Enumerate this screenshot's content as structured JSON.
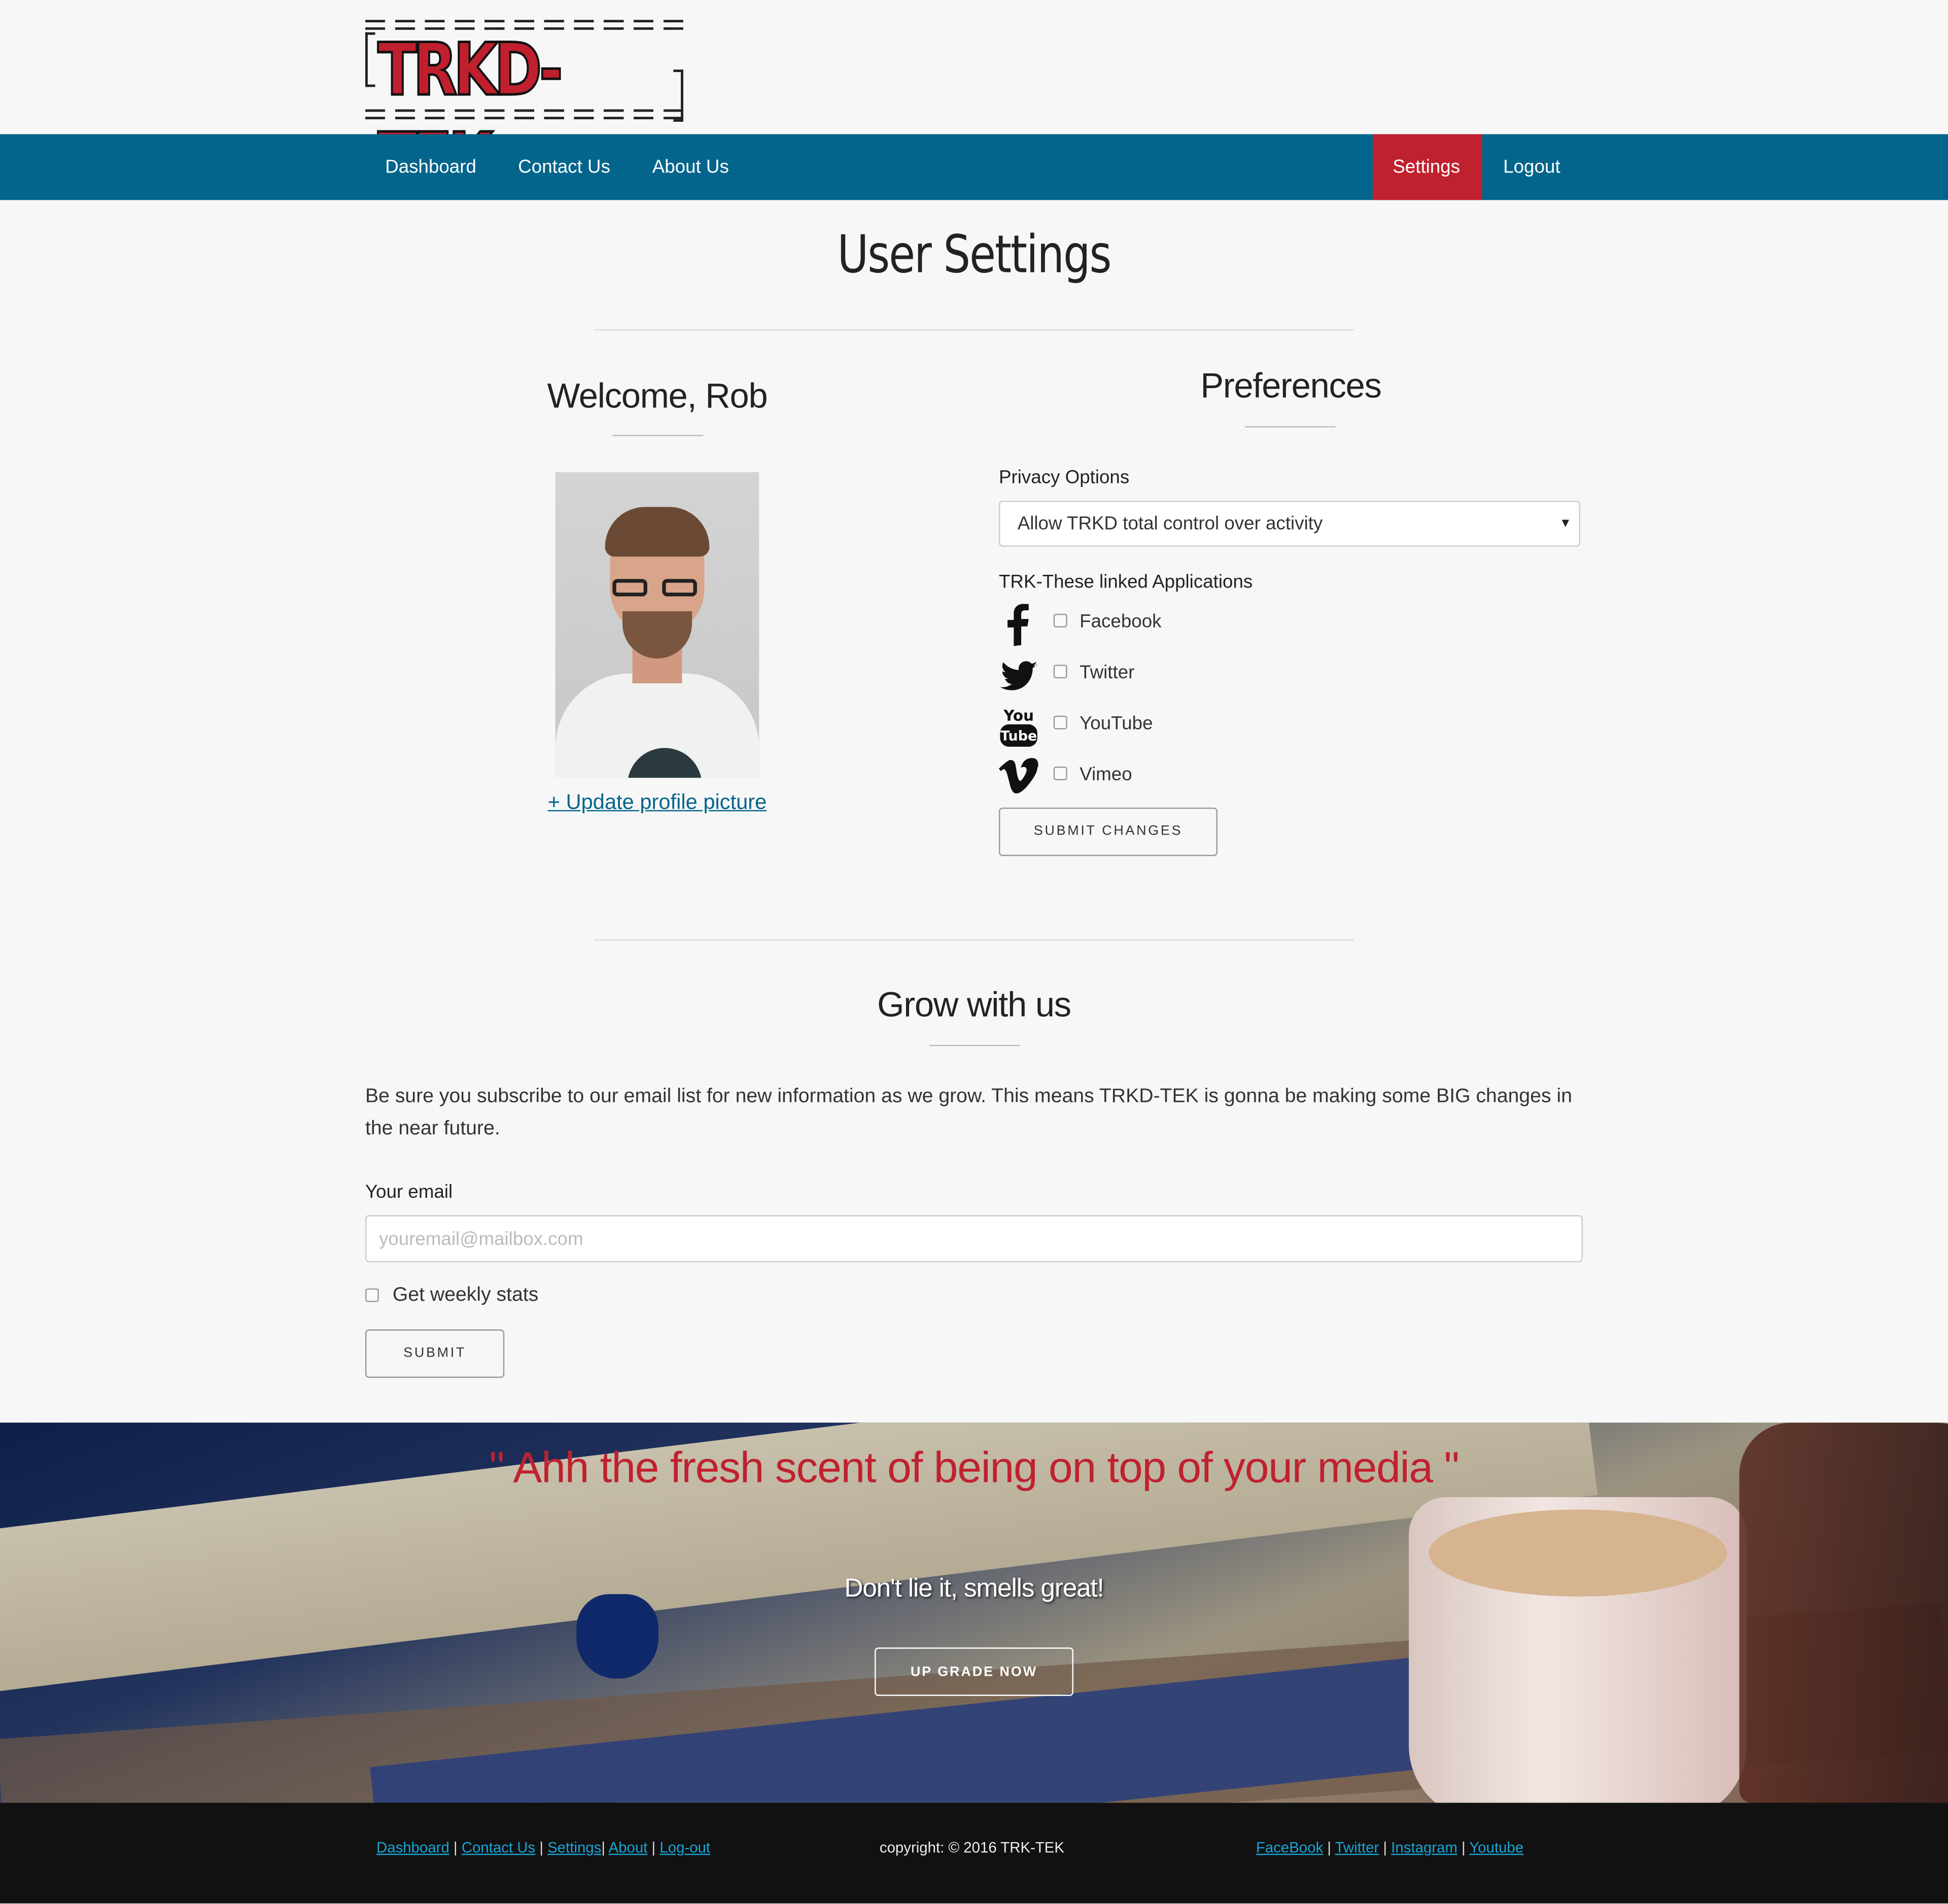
{
  "brand": {
    "logo_text": "TRKD-TEK"
  },
  "nav": {
    "left": [
      "Dashboard",
      "Contact Us",
      "About Us"
    ],
    "right": [
      "Settings",
      "Logout"
    ],
    "active": "Settings"
  },
  "page": {
    "title": "User Settings"
  },
  "profile": {
    "welcome": "Welcome, Rob",
    "update_link": "+ Update profile picture"
  },
  "preferences": {
    "title": "Preferences",
    "privacy_label": "Privacy Options",
    "privacy_value": "Allow TRKD total control over activity",
    "apps_label": "TRK-These linked Applications",
    "apps": [
      {
        "name": "Facebook",
        "icon": "facebook-icon",
        "checked": false
      },
      {
        "name": "Twitter",
        "icon": "twitter-icon",
        "checked": false
      },
      {
        "name": "YouTube",
        "icon": "youtube-icon",
        "checked": false
      },
      {
        "name": "Vimeo",
        "icon": "vimeo-icon",
        "checked": false
      }
    ],
    "submit_label": "SUBMIT CHANGES"
  },
  "grow": {
    "title": "Grow with us",
    "body": "Be sure you subscribe to our email list for new information as we grow. This means TRKD-TEK is gonna be making some BIG changes in the near future.",
    "email_label": "Your email",
    "email_placeholder": "youremail@mailbox.com",
    "email_value": "",
    "weekly_label": "Get weekly stats",
    "weekly_checked": false,
    "submit_label": "SUBMIT"
  },
  "hero": {
    "quote": "\" Ahh the fresh scent of being on top of your media \"",
    "subtext": "Don't lie it, smells great!",
    "button": "UP GRADE NOW"
  },
  "footer": {
    "links_left": [
      "Dashboard",
      "Contact Us",
      "Settings",
      "About",
      "Log-out"
    ],
    "copyright": "copyright: © 2016 TRK-TEK",
    "links_right": [
      "FaceBook",
      "Twitter",
      "Instagram",
      "Youtube"
    ]
  },
  "colors": {
    "nav": "#03658c",
    "accent": "#c0212f",
    "footer": "#111111",
    "link": "#19a6d6"
  }
}
